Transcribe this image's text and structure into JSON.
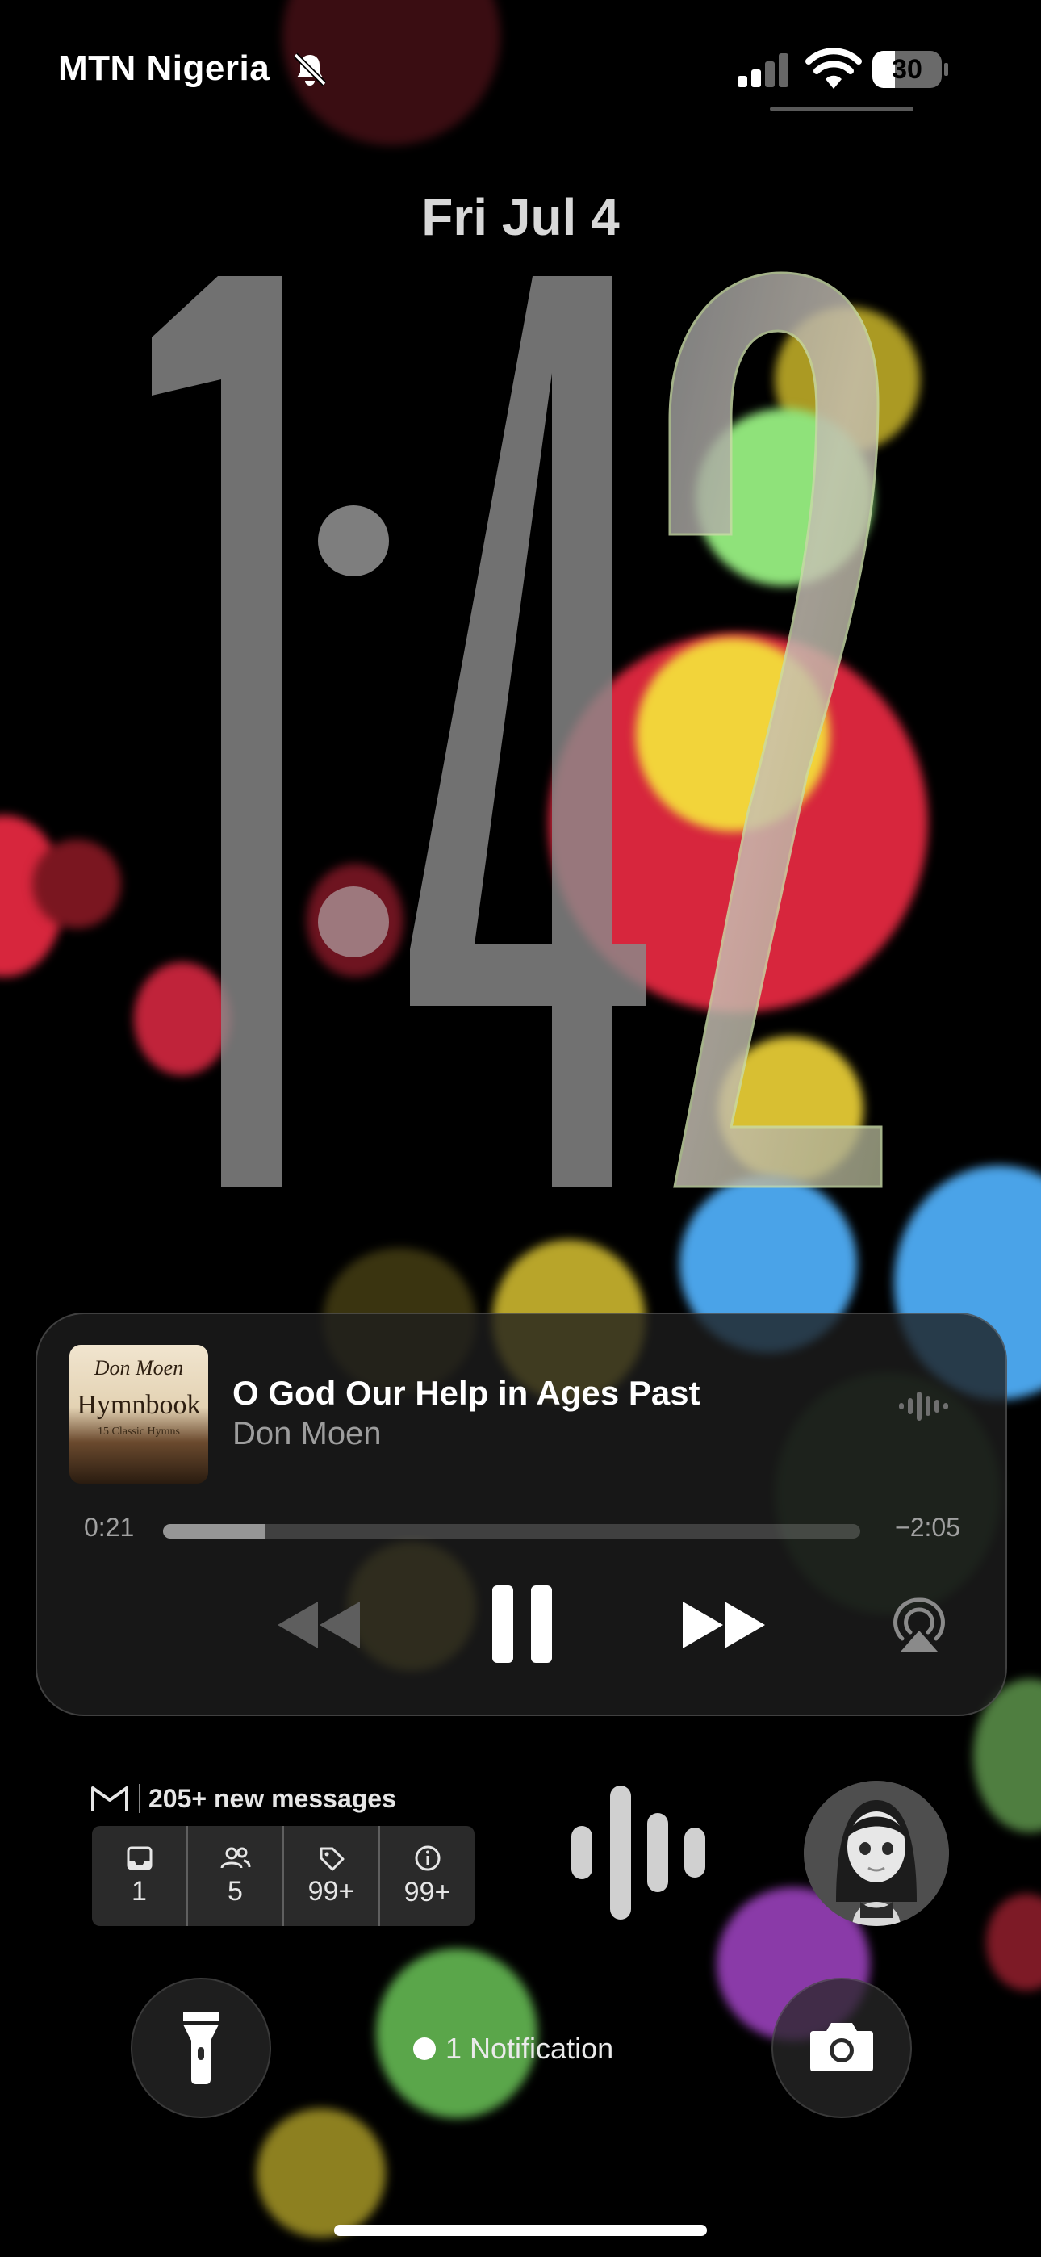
{
  "status_bar": {
    "carrier": "MTN Nigeria",
    "battery_level": "30",
    "icons": [
      "bell-slash-icon",
      "cellular-signal-icon",
      "wifi-icon",
      "battery-icon"
    ]
  },
  "lock_screen": {
    "date": "Fri Jul 4",
    "time": "1:42"
  },
  "now_playing": {
    "song_title": "O God Our Help in Ages Past",
    "artist": "Don Moen",
    "album_art_text": {
      "line1": "Don Moen",
      "line2": "Hymnbook",
      "line3": "15 Classic Hymns"
    },
    "elapsed": "0:21",
    "remaining": "−2:05",
    "progress_fraction": 0.146,
    "icons": [
      "audio-wave-icon",
      "rewind-icon",
      "pause-icon",
      "fast-forward-icon",
      "airplay-icon"
    ]
  },
  "gmail_widget": {
    "headline": "205+ new messages",
    "categories": [
      {
        "icon": "inbox-icon",
        "count": "1"
      },
      {
        "icon": "people-icon",
        "count": "5"
      },
      {
        "icon": "tag-icon",
        "count": "99+"
      },
      {
        "icon": "info-icon",
        "count": "99+"
      }
    ]
  },
  "bottom": {
    "notification_text": "1 Notification",
    "icons": [
      "flashlight-icon",
      "camera-icon"
    ]
  },
  "colors": {
    "background": "#000000",
    "clock_gray": "#8a8a8a",
    "bokeh_red": "#d7263d",
    "bokeh_yellow": "#f2d43a",
    "bokeh_green": "#8fe27a",
    "bokeh_blue": "#4aa3e8",
    "bokeh_purple": "#8a3aa8"
  }
}
